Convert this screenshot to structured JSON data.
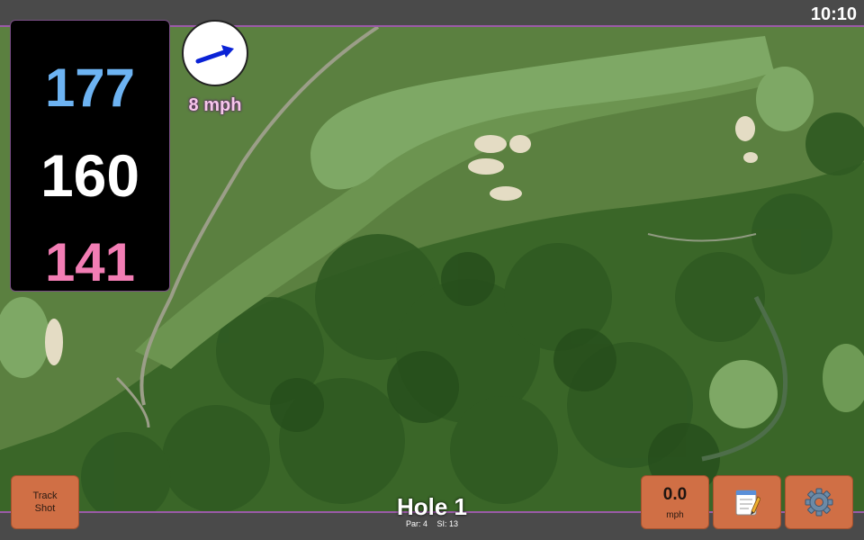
{
  "status": {
    "time": "10:10"
  },
  "distances": {
    "back": "177",
    "middle": "160",
    "front": "141"
  },
  "wind": {
    "speed_label": "8 mph",
    "icon": "arrow-icon",
    "direction": "north-east"
  },
  "hole": {
    "title": "Hole 1",
    "par": "Par: 4",
    "stroke_index": "SI: 13"
  },
  "buttons": {
    "track_line1": "Track",
    "track_line2": "Shot",
    "speed_value": "0.0",
    "speed_unit": "mph",
    "notes_icon": "notepad-icon",
    "settings_icon": "gear-icon"
  },
  "colors": {
    "back": "#6db3f2",
    "middle": "#ffffff",
    "front": "#f27db4",
    "button": "#d06f45",
    "accent": "#9b5aa8"
  }
}
